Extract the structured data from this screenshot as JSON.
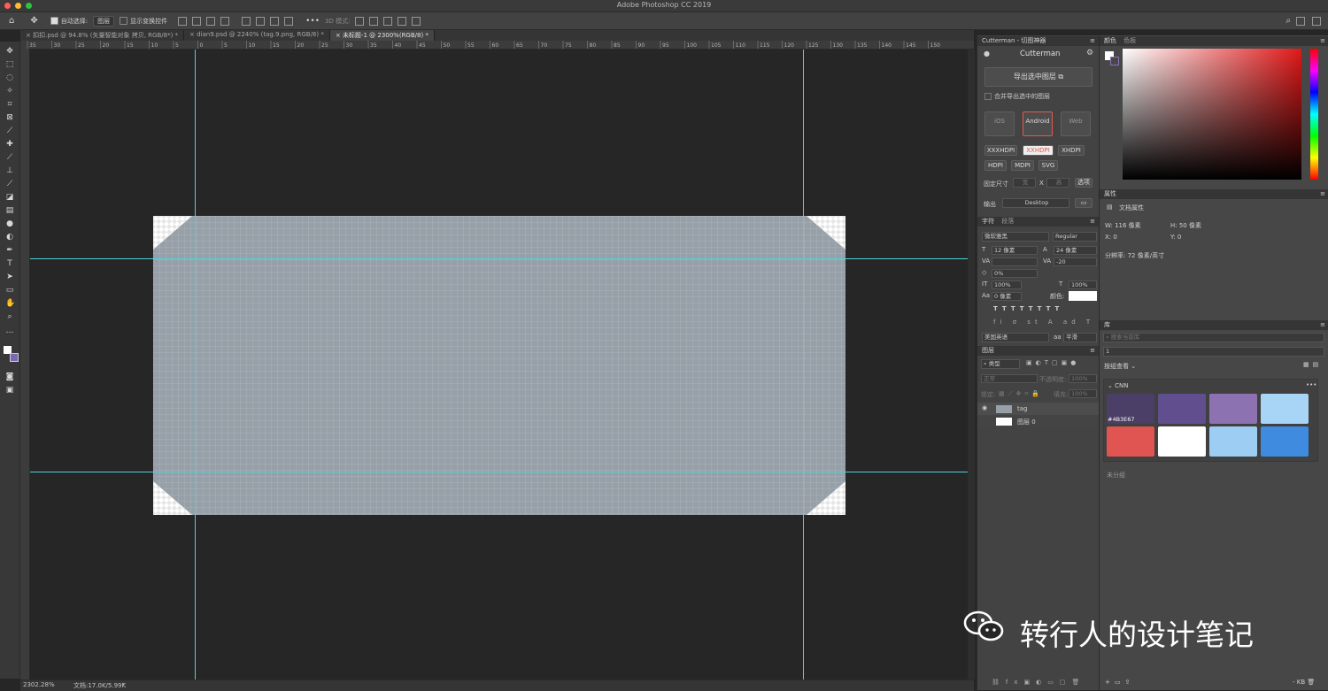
{
  "app": {
    "title": "Adobe Photoshop CC 2019"
  },
  "window_controls": {
    "close_color": "#ff5f57",
    "min_color": "#febc2e",
    "max_color": "#28c840"
  },
  "options_bar": {
    "auto_select_label": "自动选择:",
    "auto_select_value": "图层",
    "show_transform_label": "显示变换控件",
    "mode_3d_label": "3D 模式:"
  },
  "tabs": [
    {
      "label": "扣扣.psd @ 94.8% (矢量智能对象 拷贝, RGB/8*) *",
      "active": false
    },
    {
      "label": "dian9.psd @ 2240% (tag.9.png, RGB/8) *",
      "active": false
    },
    {
      "label": "未标题-1 @ 2300%(RGB/8) *",
      "active": true
    }
  ],
  "ruler_numbers": [
    "35",
    "30",
    "25",
    "20",
    "15",
    "10",
    "5",
    "0",
    "5",
    "10",
    "15",
    "20",
    "25",
    "30",
    "35",
    "40",
    "45",
    "50",
    "55",
    "60",
    "65",
    "70",
    "75",
    "80",
    "85",
    "90",
    "95",
    "100",
    "105",
    "110",
    "115",
    "120",
    "125",
    "130",
    "135",
    "140",
    "145",
    "150"
  ],
  "status": {
    "zoom": "2302.28%",
    "doc": "文档:17.0K/5.99K"
  },
  "cutterman": {
    "panel_title": "Cutterman - 切图神器",
    "user_label": "Cutterman",
    "export_button": "导出选中图层",
    "merge_label": "合并导出选中的图层",
    "platforms": [
      "iOS",
      "Android",
      "Web"
    ],
    "selected_platform": "Android",
    "densities": [
      "XXXHDPI",
      "XXHDPI",
      "XHDPI",
      "HDPI",
      "MDPI",
      "SVG"
    ],
    "selected_density": "XXHDPI",
    "fixed_size_label": "固定尺寸",
    "width_placeholder": "宽",
    "height_placeholder": "高",
    "x_label": "X",
    "choose_label": "选项",
    "output_label": "输出",
    "output_value": "Desktop"
  },
  "character": {
    "tab1": "字符",
    "tab2": "段落",
    "font": "微软雅黑",
    "style": "Regular",
    "size": "12 像素",
    "leading": "24 像素",
    "tracking": "-20",
    "kerning_percent": "0%",
    "vscale": "100%",
    "hscale": "100%",
    "baseline": "0 像素",
    "color_label": "颜色:",
    "language": "美国英语",
    "aa_label": "aa",
    "aa_value": "平滑"
  },
  "layers": {
    "title": "图层",
    "filter": "类型",
    "blend": "正常",
    "opacity_label": "不透明度:",
    "opacity_value": "100%",
    "lock_label": "锁定:",
    "fill_label": "填充:",
    "fill_value": "100%",
    "items": [
      {
        "name": "tag",
        "visible": true
      },
      {
        "name": "图层 0",
        "visible": false
      }
    ]
  },
  "color_panel": {
    "tab1": "颜色",
    "tab2": "色板"
  },
  "properties": {
    "title": "属性",
    "subtitle": "文档属性",
    "w": "W: 116 像素",
    "h": "H: 50 像素",
    "x": "X: 0",
    "y": "Y: 0",
    "resolution": "分辨率: 72 像素/英寸"
  },
  "library": {
    "title": "库",
    "search_placeholder": "搜索当前库",
    "lib_value": "1",
    "group_view": "按组查看",
    "group_name": "CNN",
    "swatches": [
      "#4B3E67",
      "#614E8E",
      "#8C72B0",
      "#A8D4F5",
      "#E05552",
      "#FFFFFF",
      "#9ECDF4",
      "#3F8BE0"
    ],
    "swatch_label": "#4B3E67",
    "ungrouped": "未分组",
    "footer_size": "KB"
  },
  "watermark": {
    "text": "转行人的设计笔记"
  }
}
